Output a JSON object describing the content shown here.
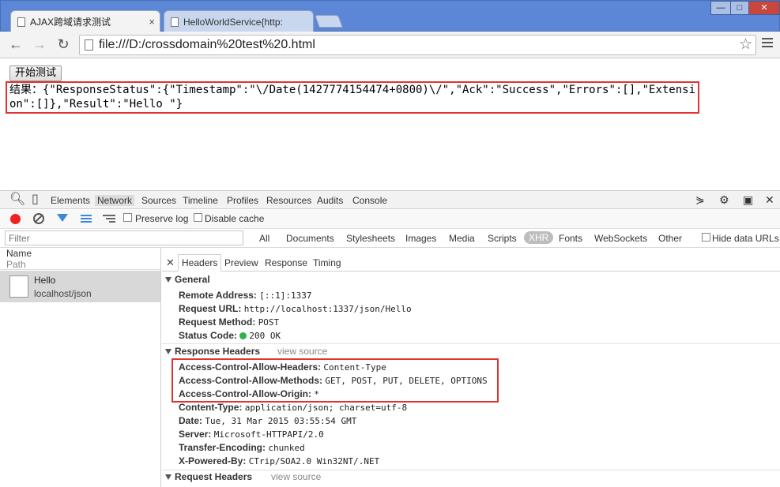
{
  "browser": {
    "tabs": [
      {
        "title": "AJAX跨域请求测试"
      },
      {
        "title": "HelloWorldService{http:"
      }
    ],
    "window_buttons": {
      "minimize": "—",
      "maximize": "□",
      "close": "✕"
    },
    "url": "file:///D:/crossdomain%20test%20.html"
  },
  "page": {
    "button_label": "开始测试",
    "result_text": "结果：{\"ResponseStatus\":{\"Timestamp\":\"\\/Date(1427774154474+0800)\\/\",\"Ack\":\"Success\",\"Errors\":[],\"Extension\":[]},\"Result\":\"Hello \"}"
  },
  "devtools": {
    "tabs": [
      "Elements",
      "Network",
      "Sources",
      "Timeline",
      "Profiles",
      "Resources",
      "Audits",
      "Console"
    ],
    "selected_tab": "Network",
    "preserve_log_label": "Preserve log",
    "disable_cache_label": "Disable cache",
    "filter_placeholder": "Filter",
    "type_filters": [
      "All",
      "Documents",
      "Stylesheets",
      "Images",
      "Media",
      "Scripts",
      "XHR",
      "Fonts",
      "WebSockets",
      "Other"
    ],
    "selected_type": "XHR",
    "hide_data_urls_label": "Hide data URLs",
    "list_header": {
      "name": "Name",
      "path": "Path"
    },
    "requests": [
      {
        "name": "Hello",
        "path": "localhost/json"
      }
    ],
    "detail_tabs": [
      "Headers",
      "Preview",
      "Response",
      "Timing"
    ],
    "general": {
      "title": "General",
      "rows": [
        {
          "key": "Remote Address:",
          "value": "[::1]:1337"
        },
        {
          "key": "Request URL:",
          "value": "http://localhost:1337/json/Hello"
        },
        {
          "key": "Request Method:",
          "value": "POST"
        },
        {
          "key": "Status Code:",
          "value": "200 OK"
        }
      ]
    },
    "response_headers": {
      "title": "Response Headers",
      "view_source": "view source",
      "rows": [
        {
          "key": "Access-Control-Allow-Headers:",
          "value": "Content-Type"
        },
        {
          "key": "Access-Control-Allow-Methods:",
          "value": "GET, POST, PUT, DELETE, OPTIONS"
        },
        {
          "key": "Access-Control-Allow-Origin:",
          "value": "*"
        },
        {
          "key": "Content-Type:",
          "value": "application/json; charset=utf-8"
        },
        {
          "key": "Date:",
          "value": "Tue, 31 Mar 2015 03:55:54 GMT"
        },
        {
          "key": "Server:",
          "value": "Microsoft-HTTPAPI/2.0"
        },
        {
          "key": "Transfer-Encoding:",
          "value": "chunked"
        },
        {
          "key": "X-Powered-By:",
          "value": "CTrip/SOA2.0 Win32NT/.NET"
        }
      ]
    },
    "request_headers": {
      "title": "Request Headers",
      "view_source": "view source"
    }
  }
}
